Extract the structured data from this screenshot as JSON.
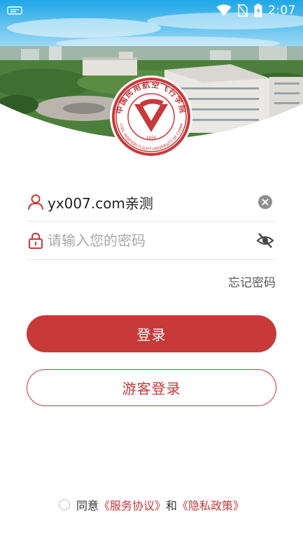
{
  "status_bar": {
    "time": "2:07",
    "icons": [
      "notification-icon",
      "wifi-icon",
      "no-sim-icon",
      "battery-charging-icon"
    ]
  },
  "emblem": {
    "year": "1956",
    "cn_name": "中国民用航空飞行学院",
    "en_name": "CIVIL AVIATION FLIGHT UNIVERSITY OF CHINA"
  },
  "form": {
    "username_value": "yx007.com亲测",
    "password_placeholder": "请输入您的密码",
    "forgot_label": "忘记密码"
  },
  "buttons": {
    "login": "登录",
    "guest": "游客登录"
  },
  "agreement": {
    "agree": "同意",
    "service_link": "《服务协议》",
    "and": "和",
    "privacy_link": "《隐私政策》"
  },
  "colors": {
    "brand_red": "#c8393a",
    "divider": "#e6e6e6",
    "placeholder": "#a8a8a8"
  }
}
